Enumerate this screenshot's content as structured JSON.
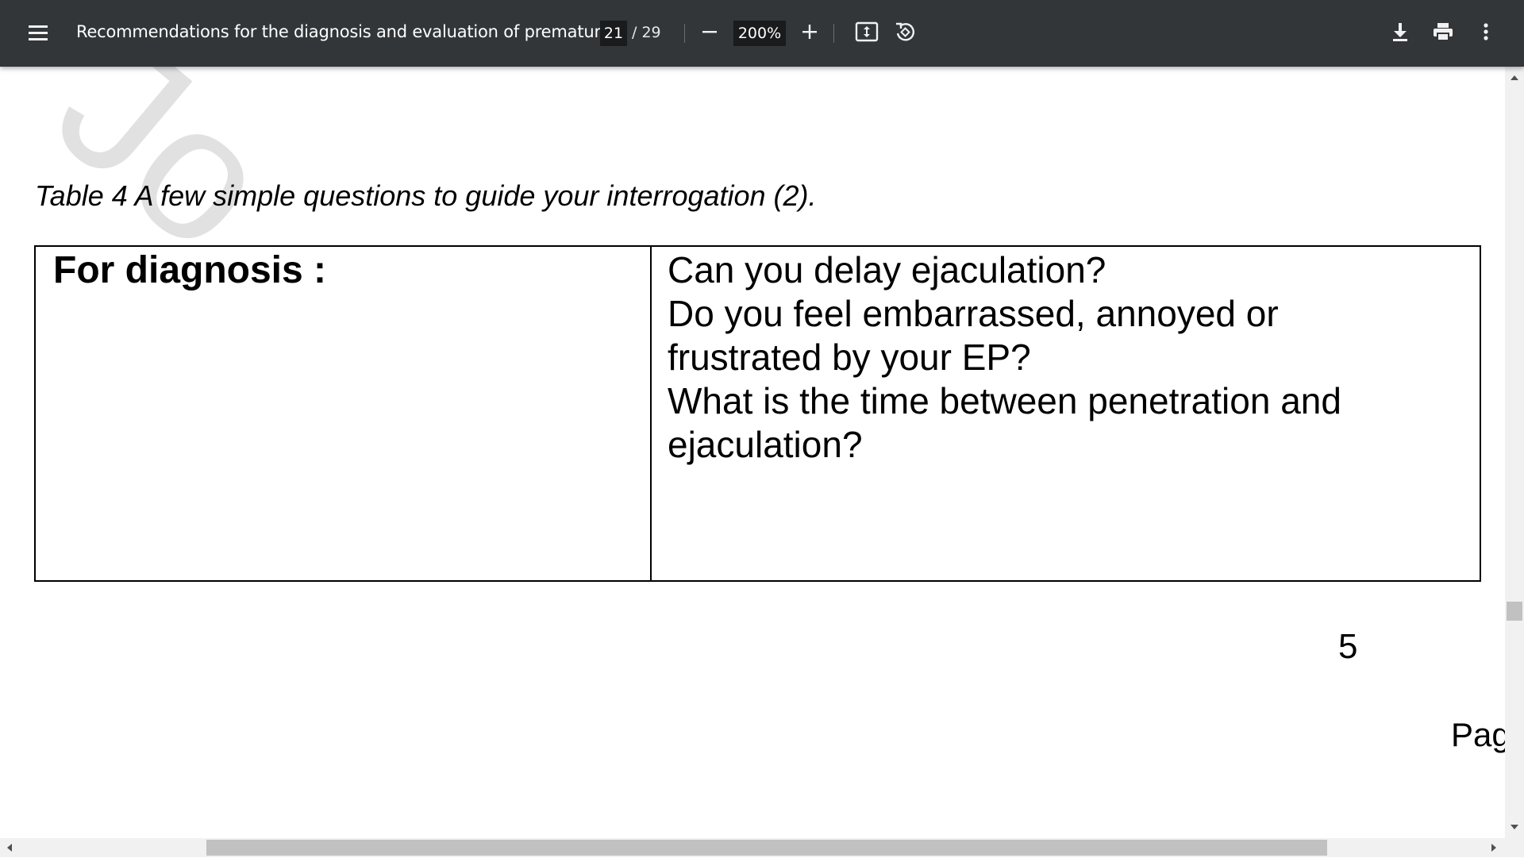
{
  "toolbar": {
    "title": "Recommendations for the diagnosis and evaluation of prematur...",
    "current_page": "21",
    "page_total": "/ 29",
    "zoom": "200%",
    "icons": [
      "menu-icon",
      "zoom-out-icon",
      "zoom-in-icon",
      "fit-page-icon",
      "rotate-icon",
      "download-icon",
      "print-icon",
      "more-options-icon"
    ]
  },
  "document": {
    "watermark": "Jo",
    "caption": "Table 4 A few simple questions to guide your interrogation (2).",
    "table": {
      "left_cell": "For diagnosis :",
      "right_cell_lines": [
        "Can you delay ejaculation?",
        "Do you feel embarrassed, annoyed or",
        "frustrated by your EP?",
        "What is the time between penetration and",
        "ejaculation?"
      ]
    },
    "page_number": "5",
    "page_label": "Pag"
  },
  "colors": {
    "toolbar_bg": "#323639",
    "input_bg": "#191b1c",
    "scrollbar_track": "#f1f1f1",
    "scrollbar_thumb": "#c1c1c1"
  }
}
